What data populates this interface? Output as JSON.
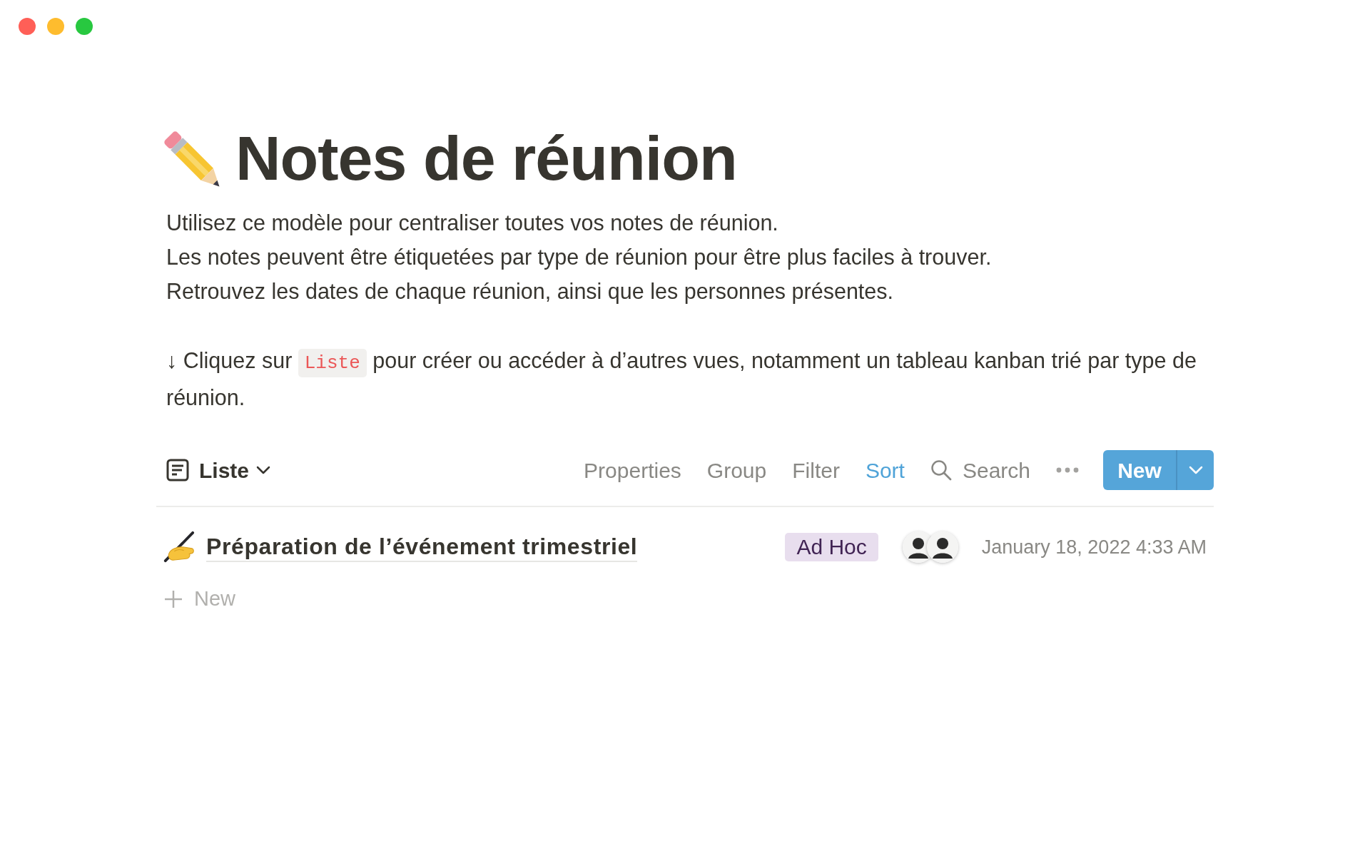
{
  "page": {
    "title": "Notes de réunion",
    "description": [
      "Utilisez ce modèle pour centraliser toutes vos notes de réunion.",
      "Les notes peuvent être étiquetées par type de réunion pour être plus faciles à trouver.",
      "Retrouvez les dates de chaque réunion, ainsi que les personnes présentes."
    ],
    "hint": [
      {
        "kind": "text",
        "text": "↓ Cliquez sur "
      },
      {
        "kind": "code",
        "text": "Liste"
      },
      {
        "kind": "text",
        "text": " pour créer ou accéder à d’autres vues, notamment un tableau kanban trié par type de réunion."
      }
    ]
  },
  "database": {
    "view": {
      "label": "Liste"
    },
    "toolbar": [
      {
        "kind": "text",
        "label": "Properties",
        "active": false
      },
      {
        "kind": "text",
        "label": "Group",
        "active": false
      },
      {
        "kind": "text",
        "label": "Filter",
        "active": false
      },
      {
        "kind": "text",
        "label": "Sort",
        "active": true
      },
      {
        "kind": "search",
        "label": "Search",
        "active": false
      },
      {
        "kind": "more"
      }
    ],
    "new_button": {
      "label": "New"
    },
    "rows": [
      {
        "title": "Préparation de l’événement trimestriel",
        "tag": {
          "label": "Ad Hoc",
          "color": "#e8deee"
        },
        "people": [
          {
            "kind": "avatar"
          },
          {
            "kind": "avatar"
          }
        ],
        "date": "January 18, 2022 4:33 AM"
      }
    ],
    "add_row": {
      "label": "New"
    }
  }
}
